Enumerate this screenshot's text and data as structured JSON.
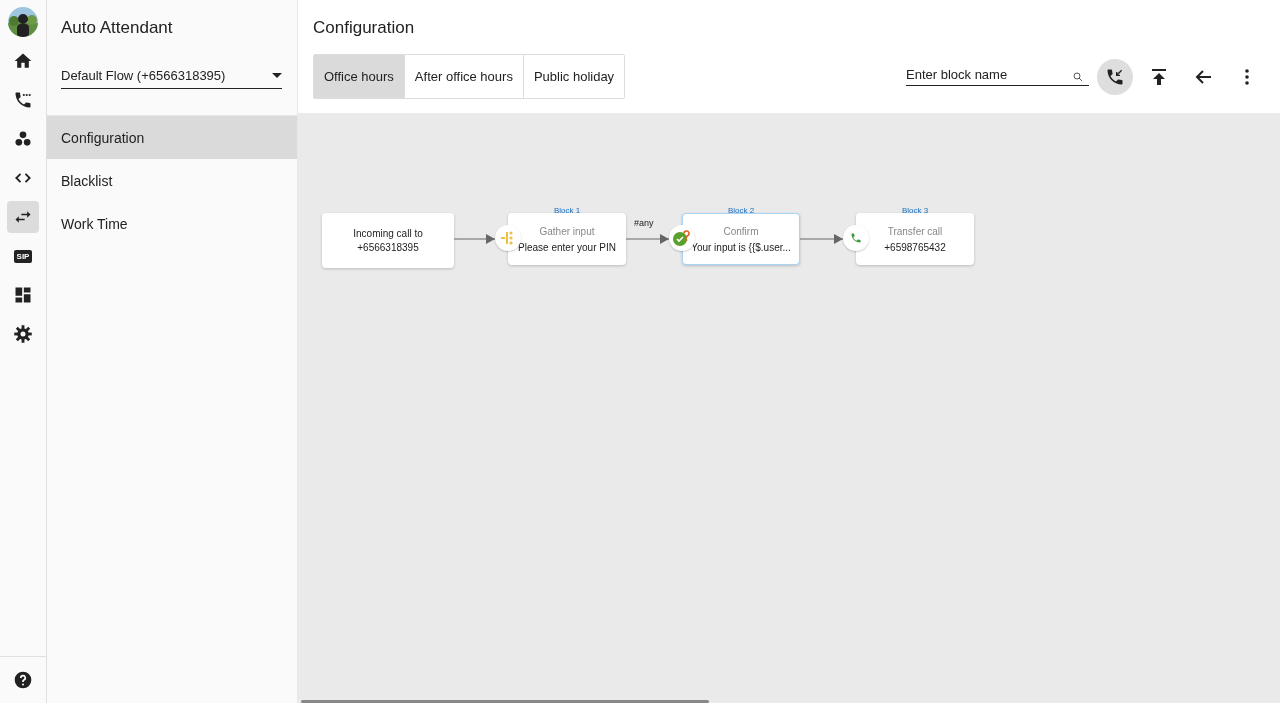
{
  "rail": [
    {
      "kind": "avatar",
      "selected": false
    },
    {
      "kind": "home",
      "selected": false
    },
    {
      "kind": "calls",
      "selected": false
    },
    {
      "kind": "groups",
      "selected": false
    },
    {
      "kind": "code",
      "selected": false
    },
    {
      "kind": "swap",
      "selected": true
    },
    {
      "kind": "sip",
      "label": "SIP",
      "selected": false
    },
    {
      "kind": "dashboard",
      "selected": false
    },
    {
      "kind": "settings",
      "selected": false
    }
  ],
  "rail_bottom": {
    "kind": "help"
  },
  "sidebar": {
    "title": "Auto Attendant",
    "flow_select": "Default Flow (+6566318395)",
    "items": [
      {
        "label": "Configuration",
        "selected": true
      },
      {
        "label": "Blacklist",
        "selected": false
      },
      {
        "label": "Work Time",
        "selected": false
      }
    ]
  },
  "main": {
    "title": "Configuration",
    "tabs": [
      {
        "label": "Office hours",
        "selected": true
      },
      {
        "label": "After office hours",
        "selected": false
      },
      {
        "label": "Public holiday",
        "selected": false
      }
    ],
    "search": {
      "placeholder": "Enter block name"
    },
    "toolbar": [
      {
        "kind": "incoming-call",
        "active": true
      },
      {
        "kind": "to-top",
        "active": false
      },
      {
        "kind": "back",
        "active": false
      },
      {
        "kind": "more",
        "active": false
      }
    ]
  },
  "flow": {
    "start": {
      "lines": [
        "Incoming call to",
        "+6566318395"
      ]
    },
    "blocks": [
      {
        "caption": "Block 1",
        "title": "Gather input",
        "text": "Please enter your PIN",
        "kind": "gather",
        "selected": false
      },
      {
        "caption": "Block 2",
        "title": "Confirm",
        "text": "Your input is {{$.user...",
        "kind": "confirm",
        "selected": true,
        "edge_label": "#any"
      },
      {
        "caption": "Block 3",
        "title": "Transfer call",
        "text": "+6598765432",
        "kind": "transfer",
        "selected": false
      }
    ]
  }
}
